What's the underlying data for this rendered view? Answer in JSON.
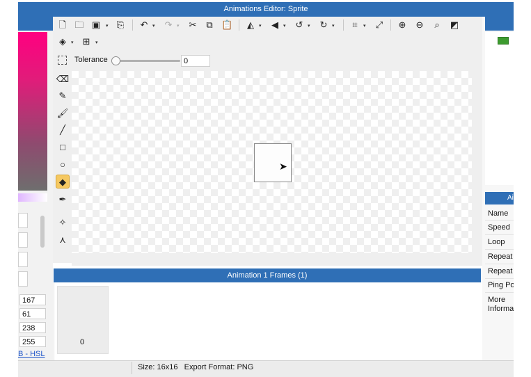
{
  "window": {
    "title": "Animations Editor: Sprite"
  },
  "toolbar": {
    "icons": [
      "new-file",
      "open-folder",
      "save",
      "export",
      "undo",
      "redo",
      "cut",
      "copy",
      "paste",
      "flip-horizontal",
      "flip-vertical",
      "rotate-left",
      "rotate-right",
      "crop",
      "resize",
      "zoom-in",
      "zoom-out",
      "zoom-fit",
      "invert-colors",
      "layers",
      "grid"
    ],
    "tolerance_label": "Tolerance",
    "tolerance_value": "0"
  },
  "tools": [
    {
      "name": "eraser",
      "active": false
    },
    {
      "name": "pencil",
      "active": false
    },
    {
      "name": "brush",
      "active": false
    },
    {
      "name": "line",
      "active": false
    },
    {
      "name": "rectangle",
      "active": false
    },
    {
      "name": "ellipse",
      "active": false
    },
    {
      "name": "fill-bucket",
      "active": true
    },
    {
      "name": "eyedropper",
      "active": false
    },
    {
      "name": "move-point",
      "active": false
    },
    {
      "name": "node-tool",
      "active": false
    }
  ],
  "color_panel": {
    "values": [
      "167",
      "61",
      "238",
      "255"
    ],
    "links": "RGB - HSL",
    "links_visible": "B - HSL"
  },
  "frames": {
    "header": "Animation 1 Frames (1)",
    "items": [
      {
        "number": "0"
      }
    ]
  },
  "status": {
    "text": "Size: 16x16   Export Format: PNG"
  },
  "properties": {
    "header": "Ai",
    "rows": [
      {
        "label": "Name"
      },
      {
        "label": "Speed"
      },
      {
        "label": "Loop"
      },
      {
        "label": "Repeat"
      },
      {
        "label": "Repeat"
      },
      {
        "label": "Ping Po"
      },
      {
        "label": "More"
      },
      {
        "label": "Informa"
      }
    ]
  },
  "colors": {
    "accent": "#2f6fb6",
    "active_tool": "#f5c861",
    "swatch_green": "#3d9b2f"
  }
}
